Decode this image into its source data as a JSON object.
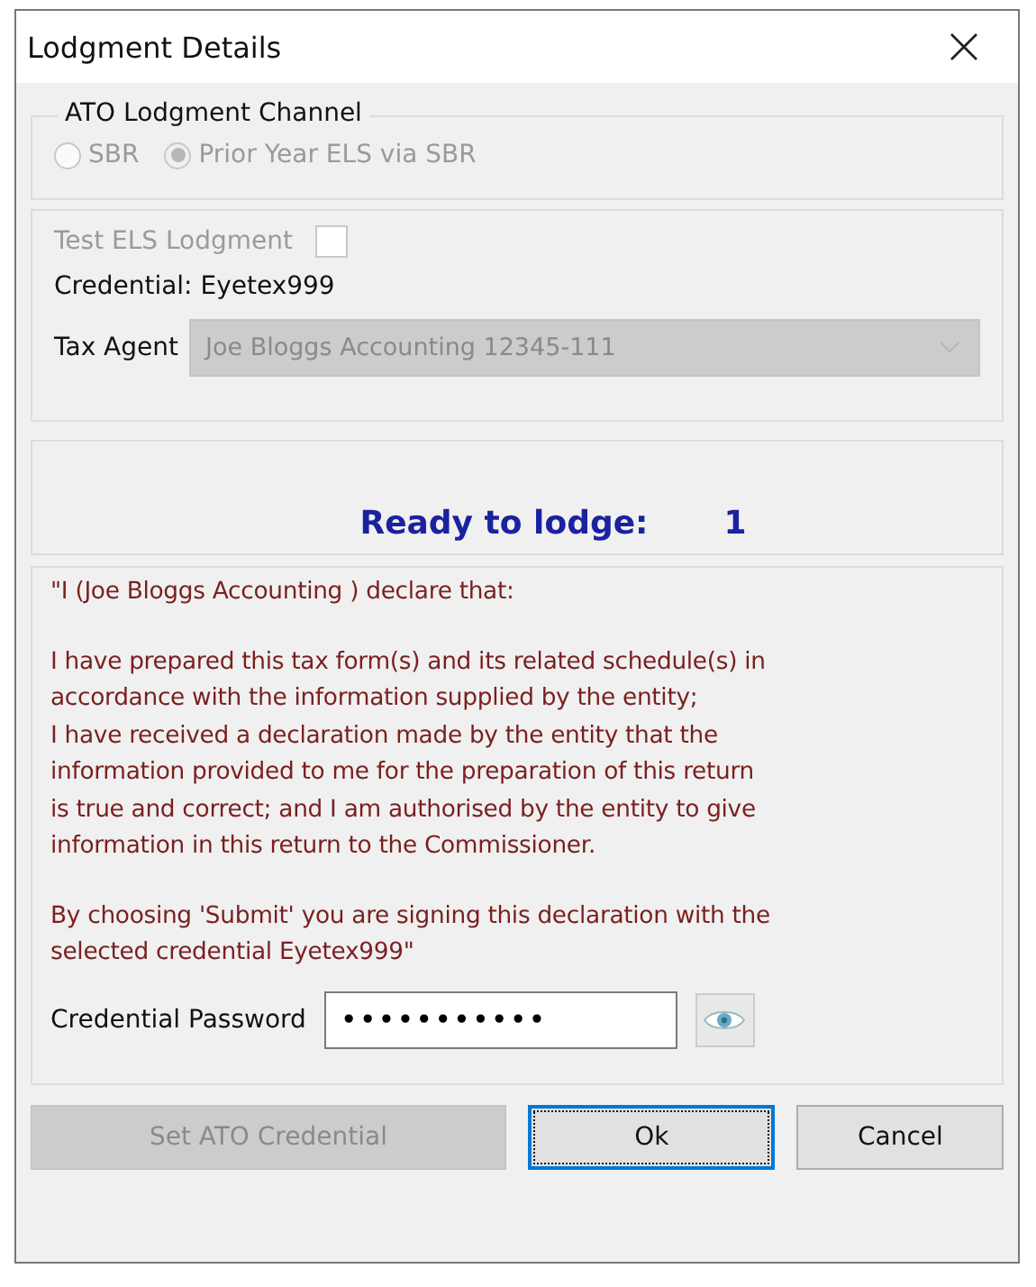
{
  "window": {
    "title": "Lodgment Details"
  },
  "channel": {
    "legend": "ATO Lodgment Channel",
    "options": [
      {
        "label": "SBR",
        "selected": false,
        "disabled": true
      },
      {
        "label": "Prior Year ELS via SBR",
        "selected": true,
        "disabled": true
      }
    ]
  },
  "test_els": {
    "label": "Test ELS Lodgment",
    "checked": false,
    "disabled": true
  },
  "credential": "Credential: Eyetex999",
  "tax_agent": {
    "label": "Tax Agent",
    "value": "Joe Bloggs Accounting 12345-111",
    "disabled": true
  },
  "status": {
    "label": "Ready to lodge:",
    "count": "1"
  },
  "declaration": [
    {
      "lines": [
        "\"I (Joe Bloggs Accounting ) declare that:"
      ]
    },
    {
      "lines": [
        "I have prepared this tax form(s) and its related schedule(s) in",
        "accordance with the information supplied by the entity;",
        "I have received a declaration made by the entity that the",
        "information provided to me for the preparation of this return",
        "is true and correct; and I am authorised by the entity to give",
        "information in this return to the Commissioner."
      ]
    },
    {
      "lines": [
        "By choosing 'Submit' you are signing this declaration with the",
        "selected credential  Eyetex999\""
      ]
    }
  ],
  "password": {
    "label": "Credential Password",
    "value": "•••••••••••"
  },
  "buttons": [
    {
      "label": "Set ATO Credential",
      "disabled": true,
      "focused": false
    },
    {
      "label": "Ok",
      "disabled": false,
      "focused": true
    },
    {
      "label": "Cancel",
      "disabled": false,
      "focused": false
    }
  ]
}
